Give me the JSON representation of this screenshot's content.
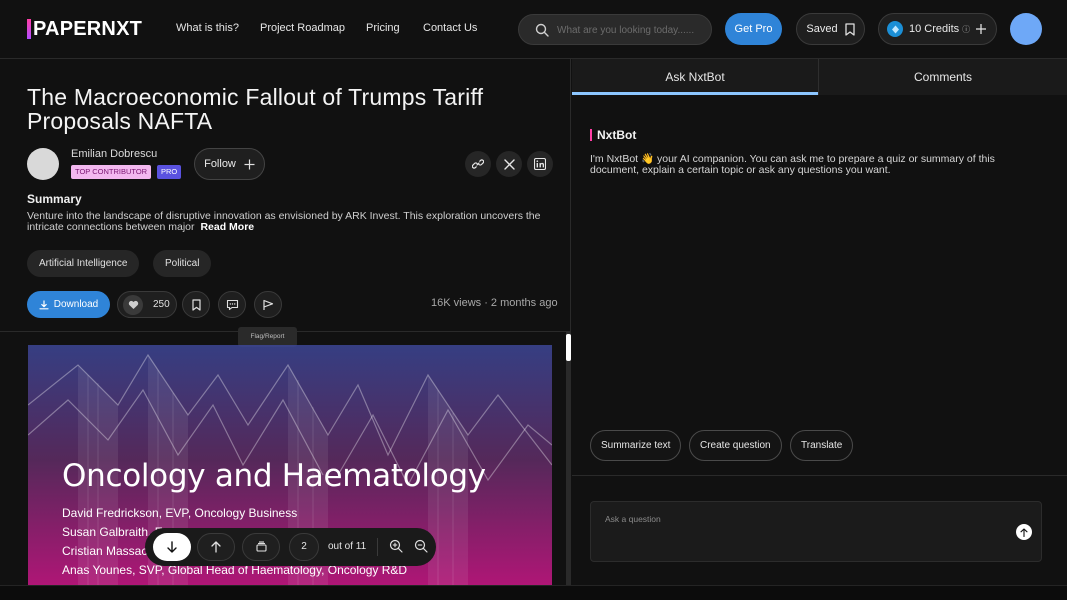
{
  "brand": {
    "logo_text": "PAPERNXT",
    "accent": "#2f84d8",
    "logo_gradient": [
      "#ff3ea5",
      "#b14cff"
    ]
  },
  "nav": {
    "links": [
      "What is this?",
      "Project Roadmap",
      "Pricing",
      "Contact Us"
    ],
    "search_placeholder": "What are you looking today......",
    "get_pro": "Get Pro",
    "saved": "Saved",
    "credits": "10 Credits"
  },
  "document": {
    "title": "The Macroeconomic Fallout of Trumps Tariff Proposals NAFTA",
    "author": {
      "name": "Emilian Dobrescu",
      "badge_contributor": "TOP CONTRIBUTOR",
      "badge_pro": "PRO"
    },
    "follow": "Follow",
    "summary_heading": "Summary",
    "summary_text": "Venture into the landscape of disruptive innovation as envisioned by ARK Invest. This exploration uncovers the intricate connections between major",
    "read_more": "Read More",
    "tags": [
      "Artificial Intelligence",
      "Political"
    ],
    "download": "Download",
    "likes": "250",
    "meta": "16K views · 2 months ago",
    "tooltip": "Flag/Report"
  },
  "preview": {
    "title": "Oncology and Haematology",
    "lines": [
      "David Fredrickson, EVP, Oncology Business",
      "Susan Galbraith, E",
      "Cristian Massac",
      "Anas Younes, SVP, Global Head of Haematology, Oncology R&D"
    ]
  },
  "pager": {
    "page": "2",
    "of_label": "out of 11"
  },
  "chat": {
    "tabs": [
      "Ask NxtBot",
      "Comments"
    ],
    "active_tab": "Ask NxtBot",
    "bot_name": "NxtBot",
    "bot_message": "I'm NxtBot 👋 your AI  companion. You can ask me to prepare a quiz or summary of this document, explain a certain topic or ask any questions you want.",
    "suggestions": [
      "Summarize text",
      "Create question",
      "Translate"
    ],
    "input_placeholder": "Ask a question"
  }
}
